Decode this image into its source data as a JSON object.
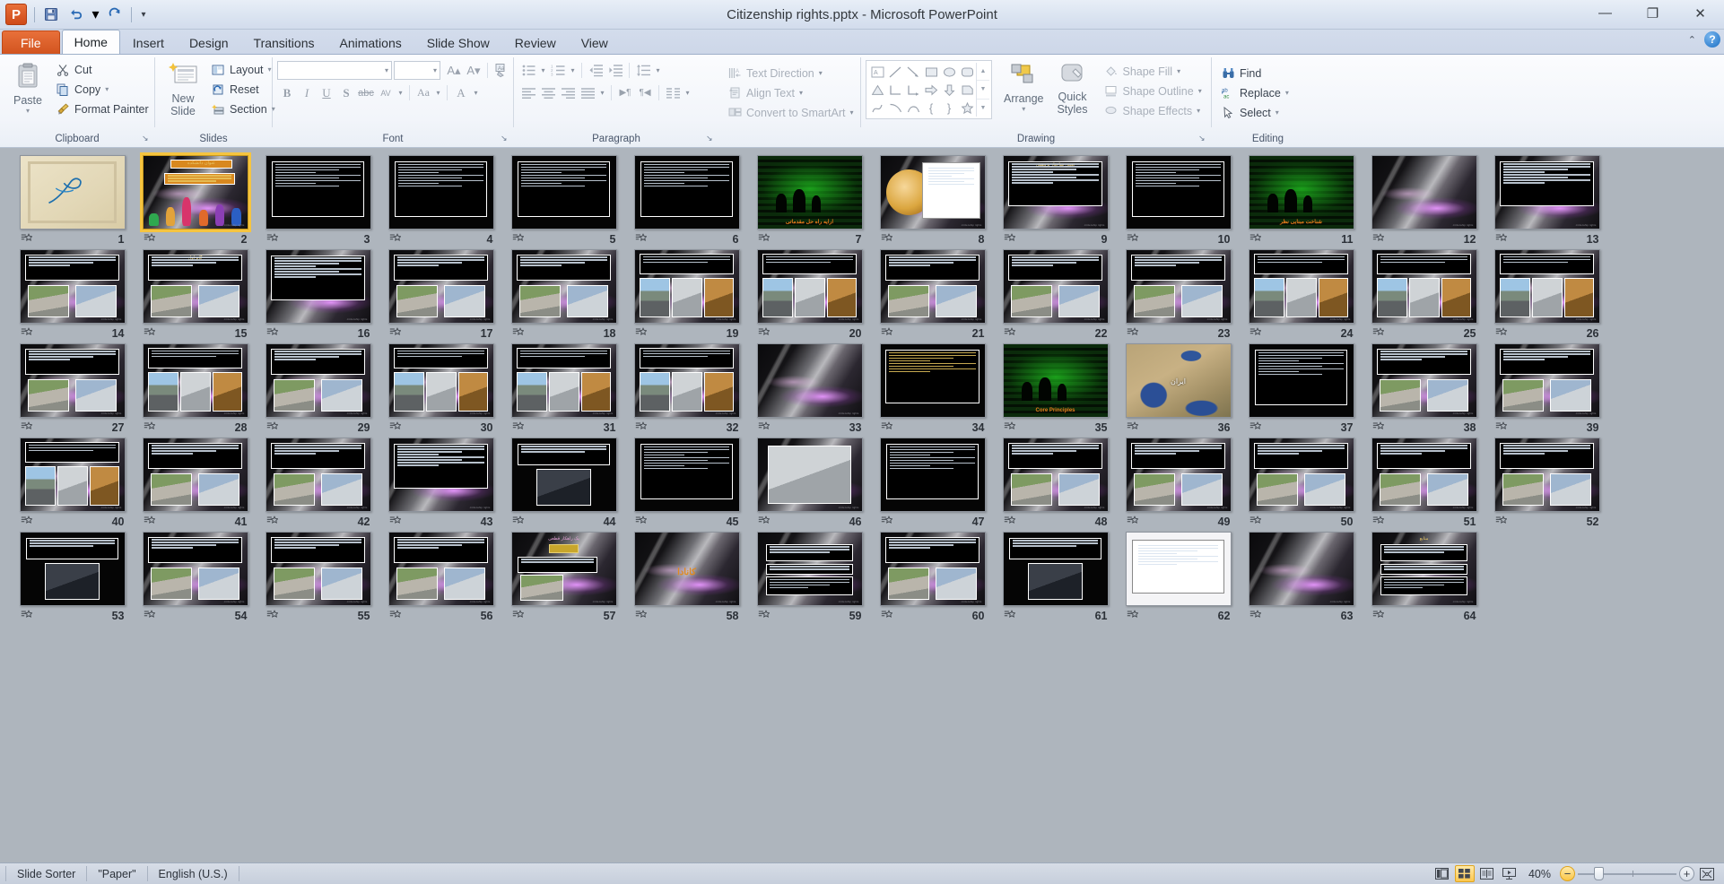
{
  "window": {
    "title": "Citizenship rights.pptx  -  Microsoft PowerPoint",
    "minimize": "—",
    "restore": "❐",
    "close": "✕",
    "ribbon_collapse": "⌃",
    "help": "?"
  },
  "qat": {
    "app_logo": "P",
    "save": "💾",
    "undo": "↶",
    "undo_caret": "▾",
    "redo": "↻",
    "customize": "▾"
  },
  "tabs": [
    {
      "label": "File",
      "kind": "file"
    },
    {
      "label": "Home",
      "kind": "active"
    },
    {
      "label": "Insert",
      "kind": "normal"
    },
    {
      "label": "Design",
      "kind": "normal"
    },
    {
      "label": "Transitions",
      "kind": "normal"
    },
    {
      "label": "Animations",
      "kind": "normal"
    },
    {
      "label": "Slide Show",
      "kind": "normal"
    },
    {
      "label": "Review",
      "kind": "normal"
    },
    {
      "label": "View",
      "kind": "normal"
    }
  ],
  "ribbon": {
    "clipboard": {
      "label": "Clipboard",
      "dialog_launcher": "↘",
      "paste": "Paste",
      "paste_caret": "▾",
      "cut": "Cut",
      "copy": "Copy",
      "copy_caret": "▾",
      "format_painter": "Format Painter"
    },
    "slides": {
      "label": "Slides",
      "new_slide_line1": "New",
      "new_slide_line2": "Slide",
      "new_slide_caret": "▾",
      "layout": "Layout",
      "layout_caret": "▾",
      "reset": "Reset",
      "section": "Section",
      "section_caret": "▾"
    },
    "font": {
      "label": "Font",
      "dialog_launcher": "↘",
      "font_name_value": "",
      "font_size_value": "",
      "grow_font": "A▴",
      "shrink_font": "A▾",
      "clear_formatting": "A⌫",
      "bold": "B",
      "italic": "I",
      "underline": "U",
      "shadow": "S",
      "strikethrough": "abc",
      "character_spacing": "AV",
      "change_case": "Aa",
      "font_color": "A"
    },
    "paragraph": {
      "label": "Paragraph",
      "dialog_launcher": "↘",
      "bullets": "☰",
      "numbering": "≡",
      "decrease_indent": "⬅",
      "increase_indent": "➡",
      "line_spacing": "↕",
      "align_left": "≡",
      "align_center": "≡",
      "align_right": "≡",
      "justify": "≡",
      "ltr": "▶¶",
      "rtl": "¶◀",
      "columns": "‖",
      "text_direction": "Text Direction",
      "align_text": "Align Text",
      "convert_to_smartart": "Convert to SmartArt"
    },
    "drawing": {
      "label": "Drawing",
      "dialog_launcher": "↘",
      "shapes": [
        "☰",
        "╲",
        "↘",
        "□",
        "○",
        "▢",
        "△",
        "⌐",
        "⌐",
        "⇒",
        "⇓",
        "◔",
        "⤳",
        "⌒",
        "⌒",
        "{",
        "}",
        "☆"
      ],
      "arrange": "Arrange",
      "arrange_caret": "▾",
      "quick_styles_line1": "Quick",
      "quick_styles_line2": "Styles",
      "quick_styles_caret": "▾",
      "shape_fill": "Shape Fill",
      "shape_outline": "Shape Outline",
      "shape_effects": "Shape Effects"
    },
    "editing": {
      "label": "Editing",
      "find": "Find",
      "replace": "Replace",
      "select": "Select"
    }
  },
  "sorter": {
    "selected_slide": 2,
    "transition_icon": "☆",
    "slides": [
      {
        "n": 1,
        "style": "cream",
        "title": ""
      },
      {
        "n": 2,
        "style": "title-people",
        "title": "عنوان دانشکده"
      },
      {
        "n": 3,
        "style": "text-black",
        "title": ""
      },
      {
        "n": 4,
        "style": "text-black",
        "title": ""
      },
      {
        "n": 5,
        "style": "text-black",
        "title": ""
      },
      {
        "n": 6,
        "style": "text-black",
        "title": ""
      },
      {
        "n": 7,
        "style": "green",
        "title": "ارایه راه حل مقدماتی"
      },
      {
        "n": 8,
        "style": "orb",
        "title": ""
      },
      {
        "n": 9,
        "style": "text-purple",
        "title": "تعیین ساختار پژوهش"
      },
      {
        "n": 10,
        "style": "text-black",
        "title": ""
      },
      {
        "n": 11,
        "style": "green",
        "title": "شناخت مبنایی نظر"
      },
      {
        "n": 12,
        "style": "plain",
        "title": ""
      },
      {
        "n": 13,
        "style": "text-purple",
        "title": ""
      },
      {
        "n": 14,
        "style": "photos2",
        "title": ""
      },
      {
        "n": 15,
        "style": "photos2",
        "title": "گام اول"
      },
      {
        "n": 16,
        "style": "text-purple",
        "title": ""
      },
      {
        "n": 17,
        "style": "photos2",
        "title": ""
      },
      {
        "n": 18,
        "style": "photos2",
        "title": ""
      },
      {
        "n": 19,
        "style": "photos3",
        "title": ""
      },
      {
        "n": 20,
        "style": "photos3",
        "title": ""
      },
      {
        "n": 21,
        "style": "photos2",
        "title": ""
      },
      {
        "n": 22,
        "style": "photos2",
        "title": ""
      },
      {
        "n": 23,
        "style": "photos2",
        "title": ""
      },
      {
        "n": 24,
        "style": "photos3",
        "title": ""
      },
      {
        "n": 25,
        "style": "photos3",
        "title": ""
      },
      {
        "n": 26,
        "style": "photos3",
        "title": ""
      },
      {
        "n": 27,
        "style": "photos2",
        "title": ""
      },
      {
        "n": 28,
        "style": "photos3",
        "title": ""
      },
      {
        "n": 29,
        "style": "photos2",
        "title": ""
      },
      {
        "n": 30,
        "style": "photos3",
        "title": ""
      },
      {
        "n": 31,
        "style": "photos3",
        "title": ""
      },
      {
        "n": 32,
        "style": "photos3",
        "title": ""
      },
      {
        "n": 33,
        "style": "plain",
        "title": ""
      },
      {
        "n": 34,
        "style": "text-amber",
        "title": ""
      },
      {
        "n": 35,
        "style": "green",
        "title": "Core Principles"
      },
      {
        "n": 36,
        "style": "map",
        "title": "ایران"
      },
      {
        "n": 37,
        "style": "text-black",
        "title": ""
      },
      {
        "n": 38,
        "style": "photos2",
        "title": ""
      },
      {
        "n": 39,
        "style": "photos2",
        "title": ""
      },
      {
        "n": 40,
        "style": "photos3",
        "title": ""
      },
      {
        "n": 41,
        "style": "photos2",
        "title": ""
      },
      {
        "n": 42,
        "style": "photos2",
        "title": ""
      },
      {
        "n": 43,
        "style": "text-purple",
        "title": ""
      },
      {
        "n": 44,
        "style": "photo-center",
        "title": ""
      },
      {
        "n": 45,
        "style": "text-black",
        "title": ""
      },
      {
        "n": 46,
        "style": "photo-big",
        "title": ""
      },
      {
        "n": 47,
        "style": "text-black",
        "title": ""
      },
      {
        "n": 48,
        "style": "photos2",
        "title": ""
      },
      {
        "n": 49,
        "style": "photos2",
        "title": ""
      },
      {
        "n": 50,
        "style": "photos2",
        "title": ""
      },
      {
        "n": 51,
        "style": "photos2",
        "title": ""
      },
      {
        "n": 52,
        "style": "photos2",
        "title": ""
      },
      {
        "n": 53,
        "style": "photo-center",
        "title": ""
      },
      {
        "n": 54,
        "style": "photos2",
        "title": ""
      },
      {
        "n": 55,
        "style": "photos2",
        "title": ""
      },
      {
        "n": 56,
        "style": "photos2",
        "title": ""
      },
      {
        "n": 57,
        "style": "photo-cap",
        "title": "یک راهکار قطعی"
      },
      {
        "n": 58,
        "style": "bigtitle",
        "title": "کانادا"
      },
      {
        "n": 59,
        "style": "text-bars",
        "title": ""
      },
      {
        "n": 60,
        "style": "photos2",
        "title": ""
      },
      {
        "n": 61,
        "style": "photo-center",
        "title": ""
      },
      {
        "n": 62,
        "style": "text-white",
        "title": ""
      },
      {
        "n": 63,
        "style": "plain",
        "title": ""
      },
      {
        "n": 64,
        "style": "text-bars",
        "title": "منابع"
      }
    ]
  },
  "status": {
    "view_mode": "Slide Sorter",
    "theme": "\"Paper\"",
    "language": "English (U.S.)",
    "view_normal": "▤",
    "view_sorter": "▦",
    "view_reading": "▧",
    "view_slideshow": "▷",
    "zoom_level": "40%",
    "zoom_out": "−",
    "zoom_in": "+",
    "fit_window": "❐"
  }
}
